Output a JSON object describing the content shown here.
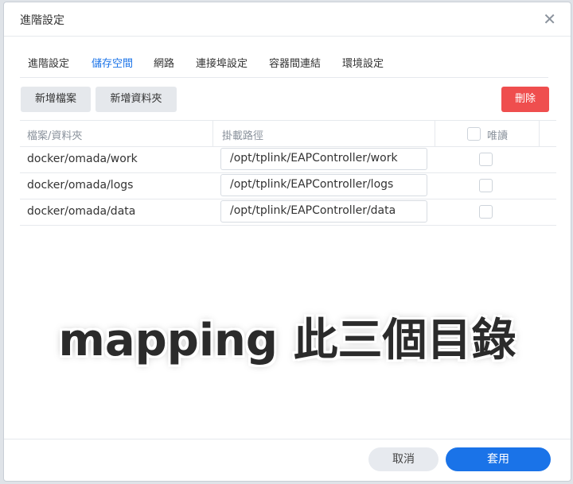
{
  "dialog": {
    "title": "進階設定",
    "close_icon": "close-icon"
  },
  "tabs": [
    {
      "label": "進階設定",
      "active": false
    },
    {
      "label": "儲存空間",
      "active": true
    },
    {
      "label": "網路",
      "active": false
    },
    {
      "label": "連接埠設定",
      "active": false
    },
    {
      "label": "容器間連結",
      "active": false
    },
    {
      "label": "環境設定",
      "active": false
    }
  ],
  "toolbar": {
    "add_file_label": "新增檔案",
    "add_folder_label": "新增資料夾",
    "delete_label": "刪除"
  },
  "table": {
    "headers": {
      "file": "檔案/資料夾",
      "mount": "掛載路徑",
      "readonly": "唯讀"
    },
    "rows": [
      {
        "file": "docker/omada/work",
        "mount": "/opt/tplink/EAPController/work",
        "readonly": false
      },
      {
        "file": "docker/omada/logs",
        "mount": "/opt/tplink/EAPController/logs",
        "readonly": false
      },
      {
        "file": "docker/omada/data",
        "mount": "/opt/tplink/EAPController/data",
        "readonly": false
      }
    ]
  },
  "overlay": {
    "text": "mapping 此三個目錄"
  },
  "footer": {
    "cancel_label": "取消",
    "apply_label": "套用"
  },
  "colors": {
    "accent": "#1a73e8",
    "danger": "#ef4e4e"
  }
}
